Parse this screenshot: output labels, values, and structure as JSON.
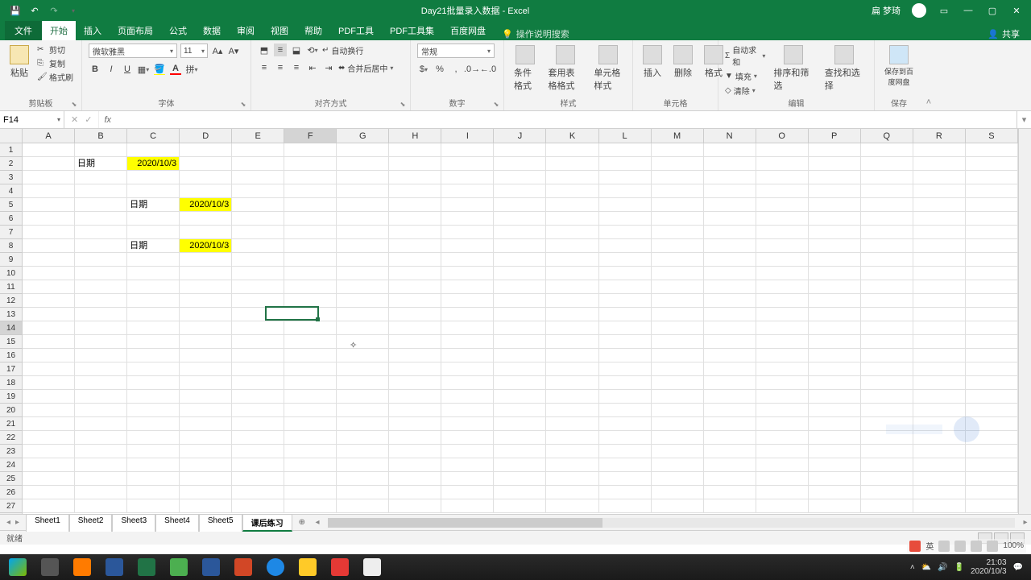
{
  "title": "Day21批量录入数据 - Excel",
  "user": "扁 梦琦",
  "tabs": {
    "file": "文件",
    "home": "开始",
    "insert": "插入",
    "layout": "页面布局",
    "formulas": "公式",
    "data": "数据",
    "review": "审阅",
    "view": "视图",
    "help": "帮助",
    "pdf": "PDF工具",
    "pdf2": "PDF工具集",
    "baidu": "百度网盘",
    "tellme": "操作说明搜索",
    "share": "共享"
  },
  "ribbon": {
    "clipboard": {
      "label": "剪贴板",
      "paste": "粘贴",
      "cut": "剪切",
      "copy": "复制",
      "brush": "格式刷"
    },
    "font": {
      "label": "字体",
      "name": "微软雅黑",
      "size": "11"
    },
    "align": {
      "label": "对齐方式",
      "wrap": "自动换行",
      "merge": "合并后居中"
    },
    "number": {
      "label": "数字",
      "format": "常规"
    },
    "styles": {
      "label": "样式",
      "cond": "条件格式",
      "table": "套用表格格式",
      "cell": "单元格样式"
    },
    "cells": {
      "label": "单元格",
      "insert": "插入",
      "delete": "删除",
      "format": "格式"
    },
    "editing": {
      "label": "编辑",
      "sum": "自动求和",
      "fill": "填充",
      "clear": "清除",
      "sort": "排序和筛选",
      "find": "查找和选择"
    },
    "save": {
      "label": "保存",
      "baidu": "保存到百度网盘"
    }
  },
  "namebox": "F14",
  "fx": "fx",
  "columns": [
    "A",
    "B",
    "C",
    "D",
    "E",
    "F",
    "G",
    "H",
    "I",
    "J",
    "K",
    "L",
    "M",
    "N",
    "O",
    "P",
    "Q",
    "R",
    "S"
  ],
  "rows_count": 27,
  "active_col": "F",
  "active_row": 14,
  "cells": {
    "r2": {
      "B": "日期",
      "C": "2020/10/3"
    },
    "r5": {
      "C": "日期",
      "D": "2020/10/3"
    },
    "r8": {
      "C": "日期",
      "D": "2020/10/3"
    }
  },
  "highlight_cells": [
    "C2",
    "D5",
    "D8"
  ],
  "sheets": [
    "Sheet1",
    "Sheet2",
    "Sheet3",
    "Sheet4",
    "Sheet5",
    "课后练习"
  ],
  "active_sheet": "课后练习",
  "status": "就绪",
  "zoom": "100%",
  "ime": "英",
  "clock": {
    "time": "21:03",
    "date": "2020/10/3"
  }
}
